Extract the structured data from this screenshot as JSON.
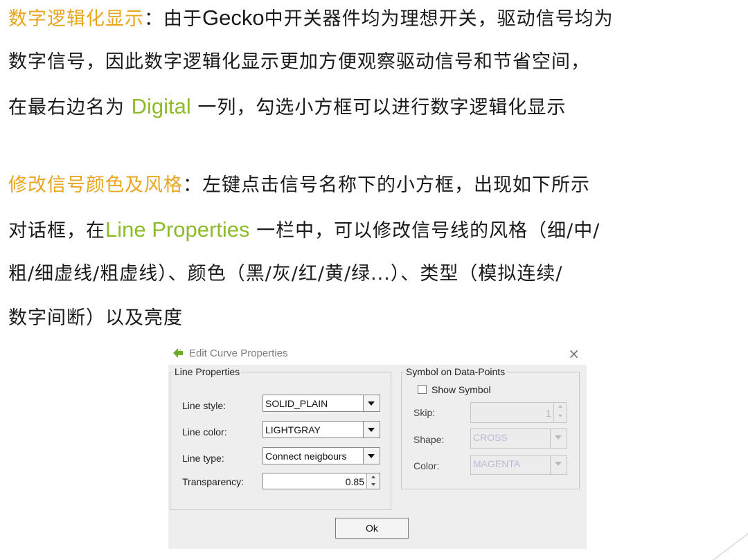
{
  "paragraph1": {
    "line1_highlight": "数字逻辑化显示",
    "line1_rest_a": "：由于",
    "line1_latin": "Gecko",
    "line1_rest_b": "中开关器件均为理想开关，驱动信号均为",
    "line2": "数字信号，因此数字逻辑化显示更加方便观察驱动信号和节省空间，",
    "line3_a": "在最右边名为 ",
    "line3_highlight": "Digital",
    "line3_b": " 一列，勾选小方框可以进行数字逻辑化显示"
  },
  "paragraph2": {
    "line1_highlight": "修改信号颜色及风格",
    "line1_rest": "：左键点击信号名称下的小方框，出现如下所示",
    "line2_a": "对话框，在",
    "line2_highlight": "Line Properties",
    "line2_b": " 一栏中，可以修改信号线的风格（细/中/",
    "line3": "粗/细虚线/粗虚线）、颜色（黑/灰/红/黄/绿...）、类型（模拟连续/",
    "line4": "数字间断）以及亮度"
  },
  "colors": {
    "highlight_orange": "#e8a520",
    "highlight_green": "#8dbb2a",
    "dialog_bg": "#eeeeee"
  },
  "dialog": {
    "title": "Edit Curve Properties",
    "close_icon": "×",
    "line_properties": {
      "legend": "Line Properties",
      "line_style_label": "Line style:",
      "line_style_value": "SOLID_PLAIN",
      "line_color_label": "Line color:",
      "line_color_value": "LIGHTGRAY",
      "line_type_label": "Line type:",
      "line_type_value": "Connect neigbours",
      "transparency_label": "Transparency:",
      "transparency_value": "0.85"
    },
    "symbol": {
      "legend": "Symbol on Data-Points",
      "show_symbol_label": "Show Symbol",
      "show_symbol_checked": false,
      "skip_label": "Skip:",
      "skip_value": "1",
      "shape_label": "Shape:",
      "shape_value": "CROSS",
      "color_label": "Color:",
      "color_value": "MAGENTA"
    },
    "ok_label": "Ok"
  }
}
